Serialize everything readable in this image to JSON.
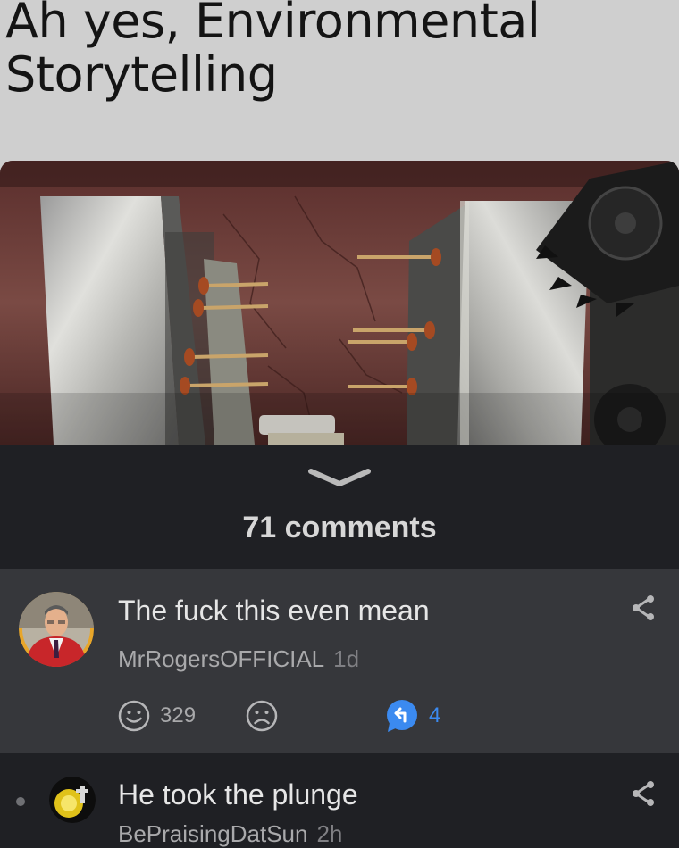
{
  "post": {
    "title": "Ah yes, Environmental Storytelling",
    "comments_count_label": "71 comments"
  },
  "comments": [
    {
      "text": "The fuck this even mean",
      "author": "MrRogersOFFICIAL",
      "age": "1d",
      "likes": "329",
      "replies": "4"
    },
    {
      "text": "He took the plunge",
      "author": "BePraisingDatSun",
      "age": "2h"
    }
  ],
  "colors": {
    "header_bg": "#cfcfcf",
    "page_bg": "#1f2024",
    "card_bg": "#36373b",
    "reply_accent": "#3b8af0"
  },
  "icons": {
    "expand": "chevron-down-icon",
    "share": "share-icon",
    "like": "smile-icon",
    "dislike": "frown-icon",
    "reply": "reply-bubble-icon"
  }
}
